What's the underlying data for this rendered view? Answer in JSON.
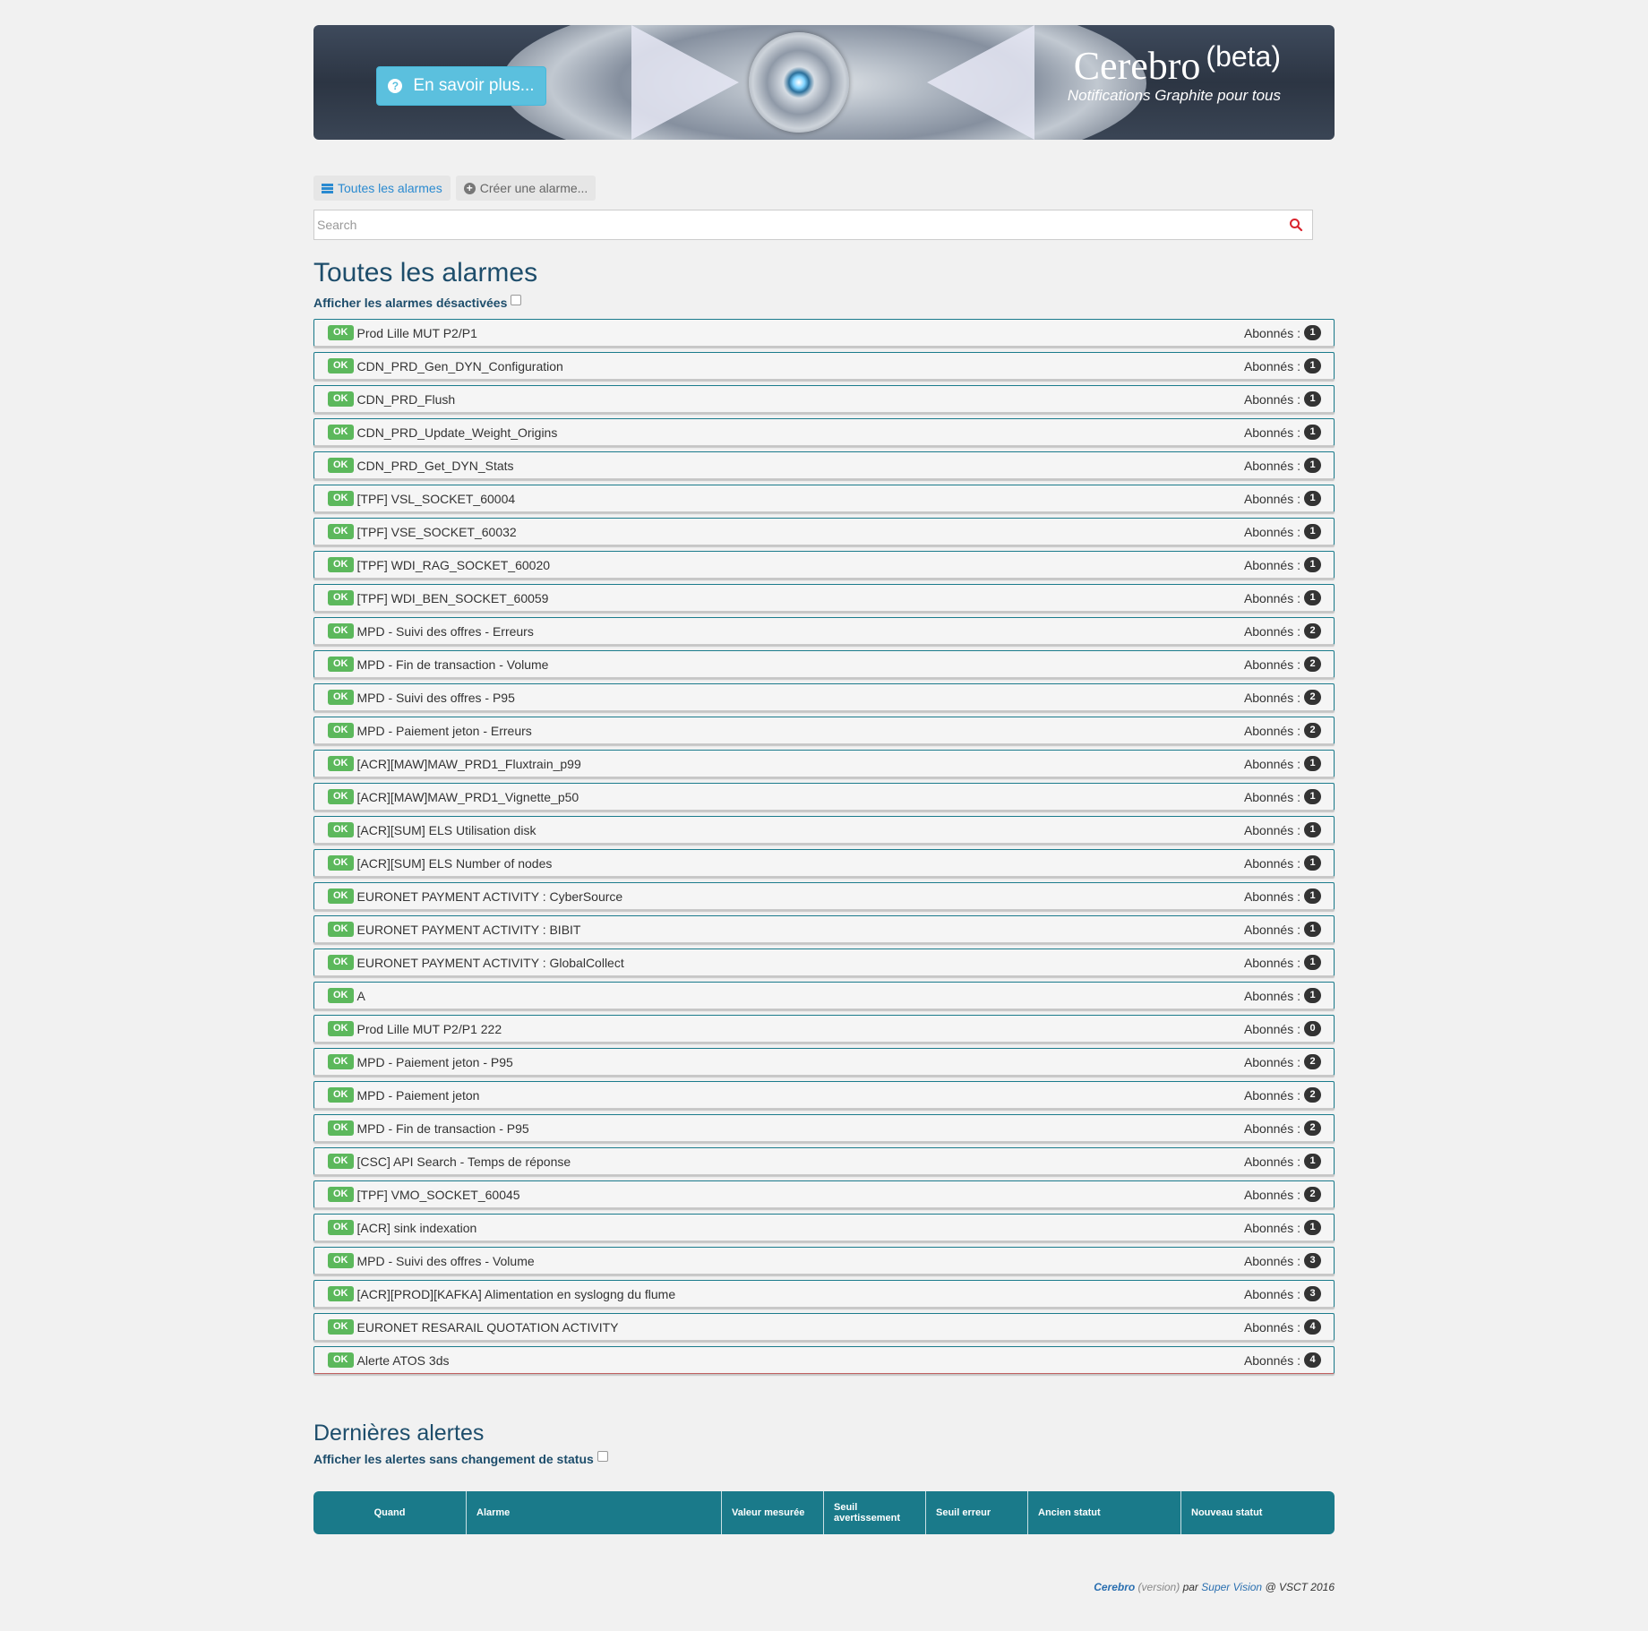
{
  "banner": {
    "info_button": "En savoir plus...",
    "brand_name": "Cerebro",
    "brand_beta": "(beta)",
    "subtitle": "Notifications Graphite pour tous"
  },
  "nav": {
    "all_alarms": "Toutes les alarmes",
    "create_alarm": "Créer une alarme..."
  },
  "search": {
    "placeholder": "Search"
  },
  "alarms_section": {
    "title": "Toutes les alarmes",
    "toggle_label": "Afficher les alarmes désactivées",
    "subscribers_label": "Abonnés :",
    "status_label": "OK",
    "items": [
      {
        "name": "Prod Lille MUT P2/P1",
        "count": "1"
      },
      {
        "name": "CDN_PRD_Gen_DYN_Configuration",
        "count": "1"
      },
      {
        "name": "CDN_PRD_Flush",
        "count": "1"
      },
      {
        "name": "CDN_PRD_Update_Weight_Origins",
        "count": "1"
      },
      {
        "name": "CDN_PRD_Get_DYN_Stats",
        "count": "1"
      },
      {
        "name": "[TPF] VSL_SOCKET_60004",
        "count": "1"
      },
      {
        "name": "[TPF] VSE_SOCKET_60032",
        "count": "1"
      },
      {
        "name": "[TPF] WDI_RAG_SOCKET_60020",
        "count": "1"
      },
      {
        "name": "[TPF] WDI_BEN_SOCKET_60059",
        "count": "1"
      },
      {
        "name": "MPD - Suivi des offres - Erreurs",
        "count": "2"
      },
      {
        "name": "MPD - Fin de transaction - Volume",
        "count": "2"
      },
      {
        "name": "MPD - Suivi des offres - P95",
        "count": "2"
      },
      {
        "name": "MPD - Paiement jeton - Erreurs",
        "count": "2"
      },
      {
        "name": "[ACR][MAW]MAW_PRD1_Fluxtrain_p99",
        "count": "1"
      },
      {
        "name": "[ACR][MAW]MAW_PRD1_Vignette_p50",
        "count": "1"
      },
      {
        "name": "[ACR][SUM] ELS Utilisation disk",
        "count": "1"
      },
      {
        "name": "[ACR][SUM] ELS Number of nodes",
        "count": "1"
      },
      {
        "name": "EURONET PAYMENT ACTIVITY : CyberSource",
        "count": "1"
      },
      {
        "name": "EURONET PAYMENT ACTIVITY : BIBIT",
        "count": "1"
      },
      {
        "name": "EURONET PAYMENT ACTIVITY : GlobalCollect",
        "count": "1"
      },
      {
        "name": "A",
        "count": "1"
      },
      {
        "name": "Prod Lille MUT P2/P1 222",
        "count": "0"
      },
      {
        "name": "MPD - Paiement jeton - P95",
        "count": "2"
      },
      {
        "name": "MPD - Paiement jeton",
        "count": "2"
      },
      {
        "name": "MPD - Fin de transaction - P95",
        "count": "2"
      },
      {
        "name": "[CSC] API Search - Temps de réponse",
        "count": "1"
      },
      {
        "name": "[TPF] VMO_SOCKET_60045",
        "count": "2"
      },
      {
        "name": "[ACR] sink indexation",
        "count": "1"
      },
      {
        "name": "MPD - Suivi des offres - Volume",
        "count": "3"
      },
      {
        "name": "[ACR][PROD][KAFKA] Alimentation en syslogng du flume",
        "count": "3"
      },
      {
        "name": "EURONET RESARAIL QUOTATION ACTIVITY",
        "count": "4"
      },
      {
        "name": "Alerte ATOS 3ds",
        "count": "4"
      }
    ]
  },
  "alerts_section": {
    "title": "Dernières alertes",
    "toggle_label": "Afficher les alertes sans changement de status",
    "columns": [
      "Quand",
      "Alarme",
      "Valeur mesurée",
      "Seuil avertissement",
      "Seuil erreur",
      "Ancien statut",
      "Nouveau statut"
    ]
  },
  "footer": {
    "app": "Cerebro",
    "version": "(version)",
    "par": "par",
    "team": "Super Vision",
    "rest": "@ VSCT 2016"
  },
  "colors": {
    "accent": "#1a7a8a",
    "ok_badge": "#5cb85c",
    "info_button": "#5bc0de",
    "heading": "#1d4d6b"
  }
}
